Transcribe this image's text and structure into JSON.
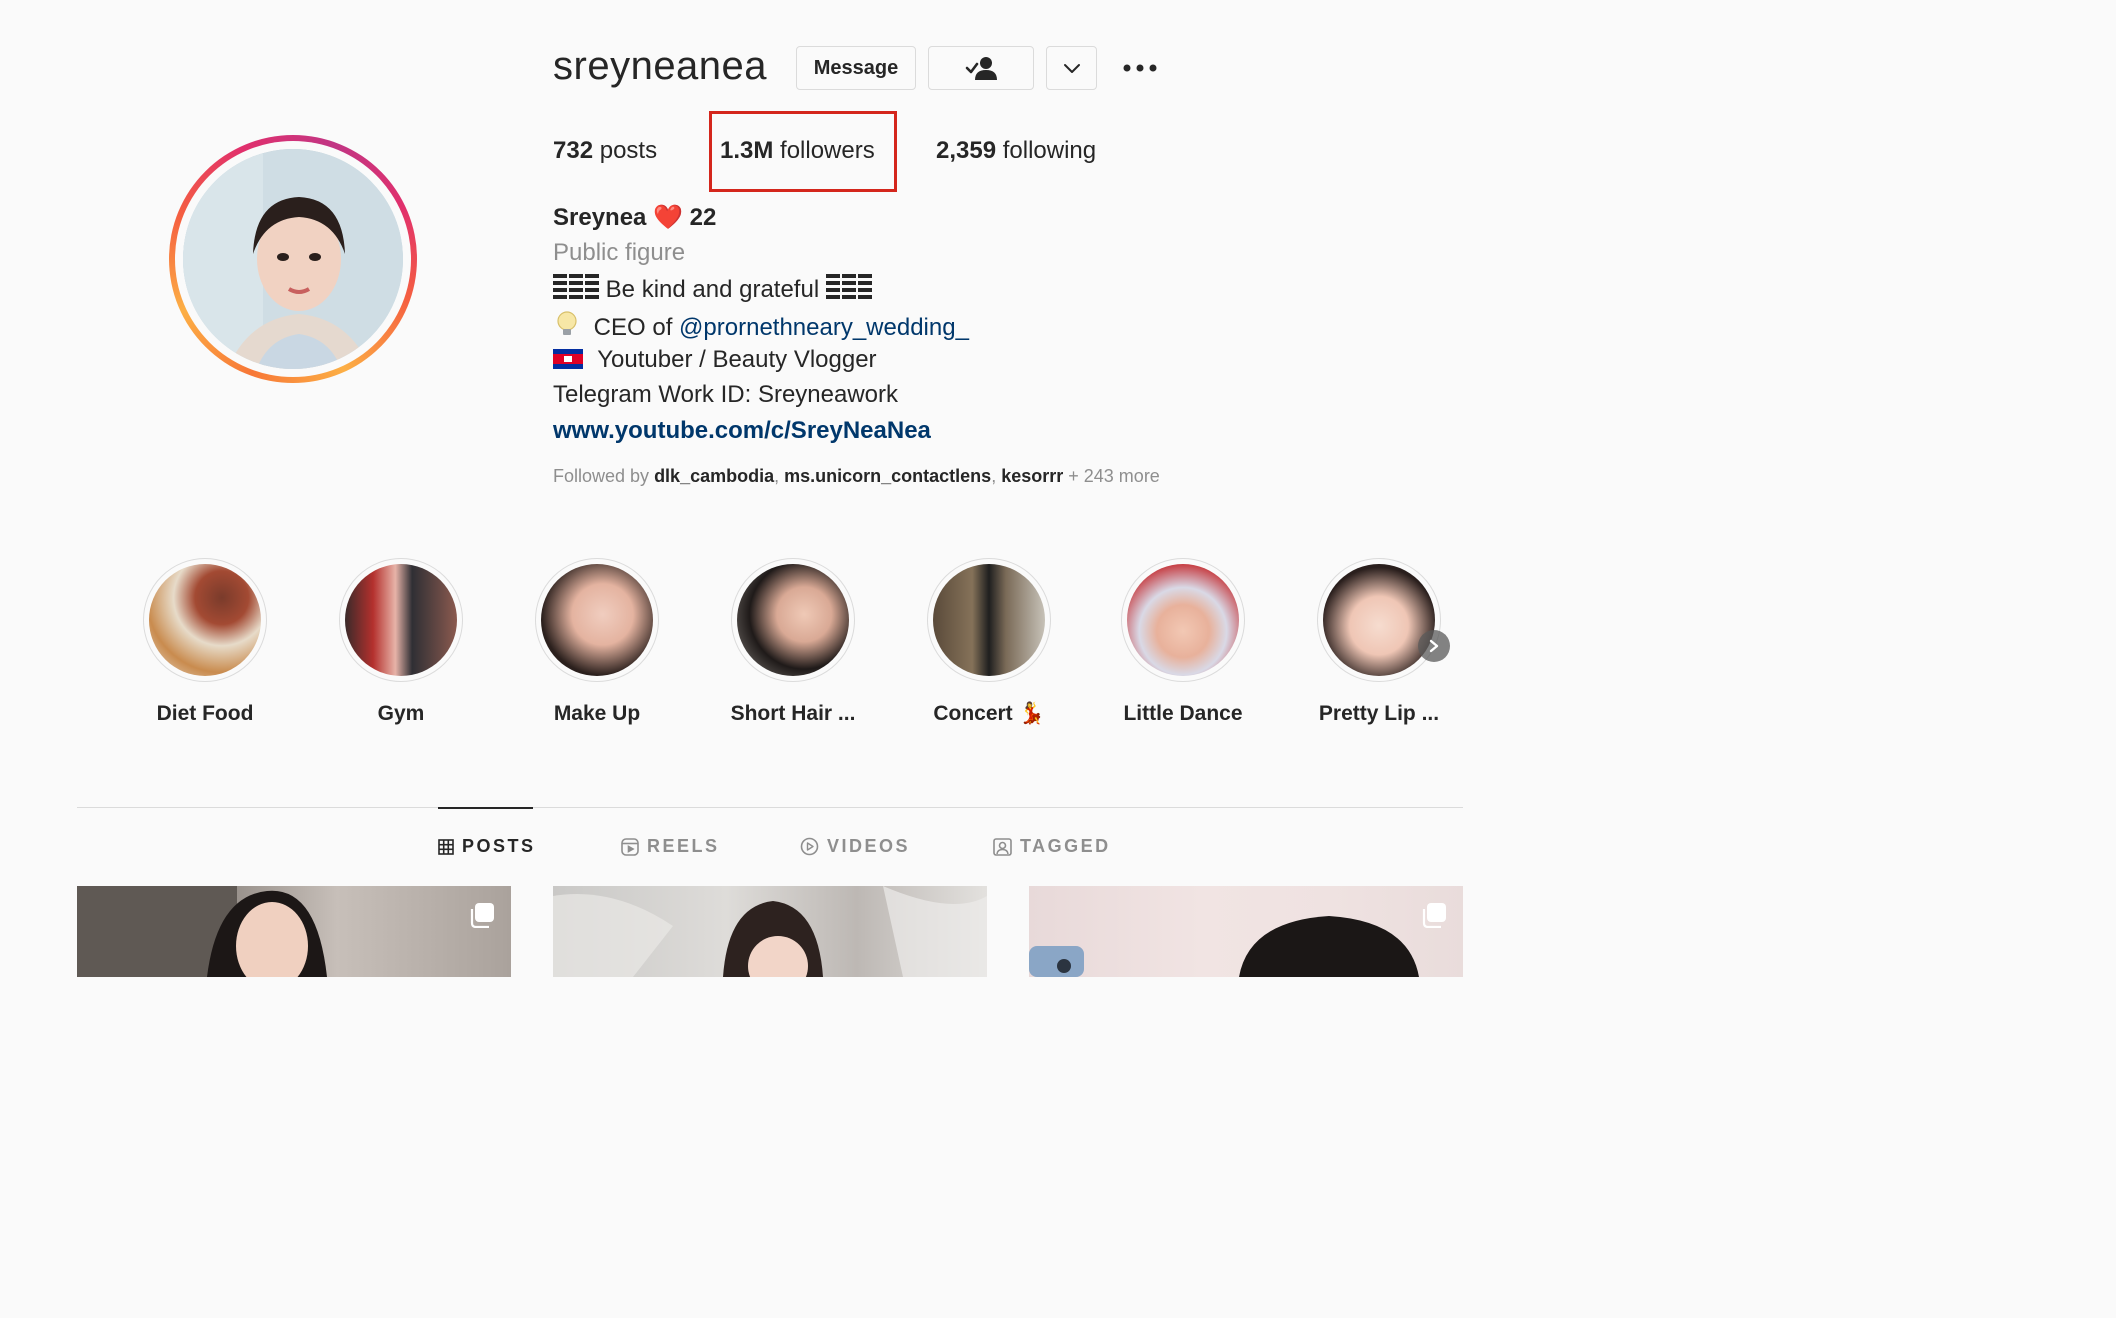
{
  "profile": {
    "username": "sreyneanea",
    "buttons": {
      "message": "Message"
    },
    "stats": {
      "posts_count": "732",
      "posts_label": "posts",
      "followers_count": "1.3M",
      "followers_label": "followers",
      "following_count": "2,359",
      "following_label": "following"
    },
    "bio": {
      "name": "Sreynea",
      "name_emoji": "❤️",
      "name_suffix": "22",
      "category": "Public figure",
      "line1": "Be kind and grateful",
      "line2_prefix": "CEO of",
      "line2_mention": "@prornethneary_wedding_",
      "line3": "Youtuber / Beauty Vlogger",
      "line4": "Telegram Work ID: Sreyneawork",
      "link": "www.youtube.com/c/SreyNeaNea"
    },
    "followed_by": {
      "prefix": "Followed by",
      "users": [
        "dlk_cambodia",
        "ms.unicorn_contactlens",
        "kesorrr"
      ],
      "more": "+ 243 more"
    }
  },
  "highlights": [
    {
      "label": "Diet Food"
    },
    {
      "label": "Gym"
    },
    {
      "label": "Make Up"
    },
    {
      "label": "Short Hair ..."
    },
    {
      "label": "Concert 💃"
    },
    {
      "label": "Little Dance"
    },
    {
      "label": "Pretty Lip ..."
    }
  ],
  "tabs": [
    {
      "label": "POSTS",
      "icon": "grid-icon",
      "active": true
    },
    {
      "label": "REELS",
      "icon": "reels-icon",
      "active": false
    },
    {
      "label": "VIDEOS",
      "icon": "play-icon",
      "active": false
    },
    {
      "label": "TAGGED",
      "icon": "tagged-icon",
      "active": false
    }
  ],
  "colors": {
    "highlight_box": "#d4261c",
    "link": "#00376b",
    "muted": "#8e8e8e"
  }
}
